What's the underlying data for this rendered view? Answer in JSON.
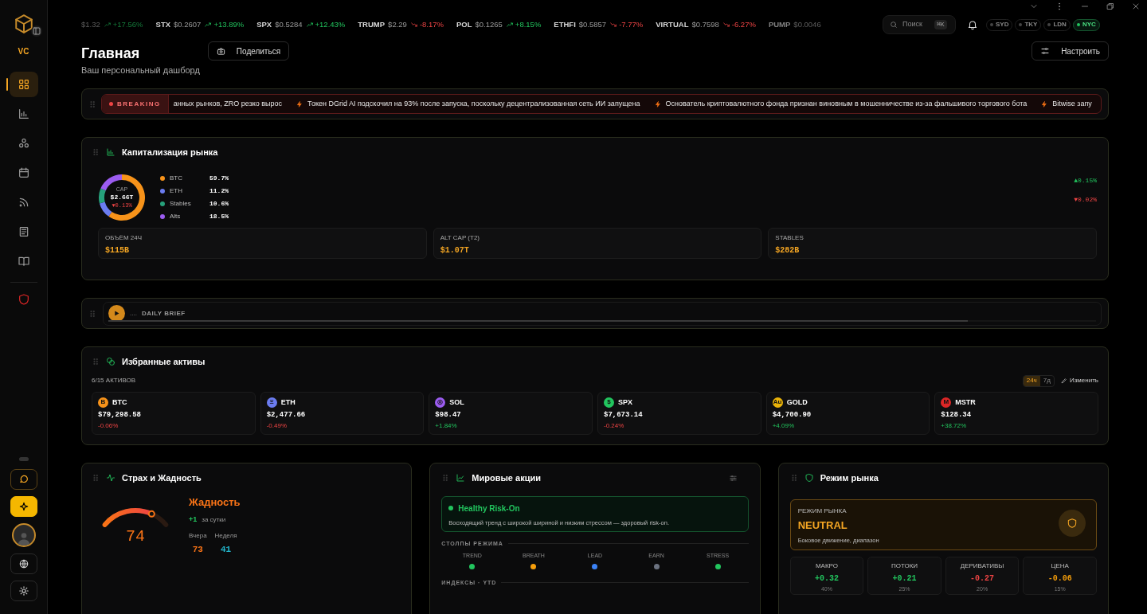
{
  "sidebar": {
    "logo_text": "VC",
    "nav": [
      {
        "selected": true
      },
      {
        "selected": false
      },
      {
        "selected": false
      },
      {
        "selected": false
      },
      {
        "selected": false
      },
      {
        "selected": false
      },
      {
        "selected": false
      },
      {
        "selected": false
      }
    ]
  },
  "ticker": [
    {
      "price": "$1.32",
      "change": "+17.56%",
      "kind": "up",
      "faded": true
    },
    {
      "symbol": "STX",
      "price": "$0.2607",
      "change": "+13.89%",
      "kind": "up",
      "faded": false
    },
    {
      "symbol": "SPX",
      "price": "$0.5284",
      "change": "+12.43%",
      "kind": "up",
      "faded": false
    },
    {
      "symbol": "TRUMP",
      "price": "$2.29",
      "change": "-8.17%",
      "kind": "down",
      "faded": false
    },
    {
      "symbol": "POL",
      "price": "$0.1265",
      "change": "+8.15%",
      "kind": "up",
      "faded": false
    },
    {
      "symbol": "ETHFI",
      "price": "$0.5857",
      "change": "-7.77%",
      "kind": "down",
      "faded": false
    },
    {
      "symbol": "VIRTUAL",
      "price": "$0.7598",
      "change": "-6.27%",
      "kind": "down",
      "faded": false
    },
    {
      "symbol": "PUMP",
      "price": "$0.0046",
      "faded": true
    }
  ],
  "search": {
    "placeholder": "Поиск",
    "shortcut": "⌘K"
  },
  "sessions": [
    {
      "label": "SYD",
      "selected": false
    },
    {
      "label": "TKY",
      "selected": false
    },
    {
      "label": "LDN",
      "selected": false
    },
    {
      "label": "NYC",
      "selected": true
    }
  ],
  "header": {
    "title": "Главная",
    "subtitle": "Ваш персональный дашборд",
    "share": "Поделиться",
    "customize": "Настроить"
  },
  "breaking": {
    "label": "BREAKING",
    "headlines": [
      {
        "text": "анных рынков, ZRO резко вырос",
        "bolt": false
      },
      {
        "text": "Токен DGrid AI подскочил на 93% после запуска, поскольку децентрализованная сеть ИИ запущена",
        "bolt": true
      },
      {
        "text": "Основатель криптовалютного фонда признан виновным в мошенничестве из-за фальшивого торгового бота",
        "bolt": true
      },
      {
        "text": "Bitwise запу",
        "bolt": true
      }
    ]
  },
  "market_cap": {
    "title": "Капитализация рынка",
    "donut": {
      "label": "CAP",
      "total": "$2.66T",
      "change": "▼0.13%",
      "kind": "down",
      "chart_data": {
        "type": "donut",
        "categories": [
          "BTC",
          "ETH",
          "Stables",
          "Alts"
        ],
        "values": [
          59.7,
          11.2,
          10.6,
          18.5
        ]
      }
    },
    "legend": [
      {
        "value": "59.7%",
        "color": "#f7931a"
      },
      {
        "value": "11.2%",
        "color": "#6b7cf0"
      },
      {
        "value": "10.6%",
        "color": "#26a17b"
      },
      {
        "value": "18.5%",
        "color": "#9b5cf0"
      }
    ],
    "side_changes": [
      {
        "text": "▲0.15%",
        "kind": "up"
      },
      {
        "text": "▼0.02%",
        "kind": "down"
      }
    ],
    "stats": [
      {
        "label": "ОБЪЁМ 24Ч",
        "value": "$115B"
      },
      {
        "label": "ALT CAP (T2)",
        "value": "$1.07T"
      },
      {
        "label": "STABLES",
        "value": "$282B"
      }
    ]
  },
  "daily_brief": {
    "dots": "....",
    "label": "DAILY BRIEF",
    "level": 0.87
  },
  "favorites": {
    "title": "Избранные активы",
    "count": "6/15 АКТИВОВ",
    "periods": [
      {
        "label": "24ч",
        "selected": true
      },
      {
        "label": "7д",
        "selected": false
      }
    ],
    "edit": "Изменить",
    "assets": [
      {
        "badge": "B",
        "color": "#f7931a",
        "symbol": "BTC",
        "price": "$79,298.58",
        "change": "-0.06%",
        "kind": "down"
      },
      {
        "badge": "Ξ",
        "color": "#6b7cf0",
        "symbol": "ETH",
        "price": "$2,477.66",
        "change": "-0.49%",
        "kind": "down"
      },
      {
        "badge": "◎",
        "color": "#9b5cf0",
        "symbol": "SOL",
        "price": "$98.47",
        "change": "+1.84%",
        "kind": "up"
      },
      {
        "badge": "$",
        "color": "#22c55e",
        "symbol": "SPX",
        "price": "$7,673.14",
        "change": "-0.24%",
        "kind": "down"
      },
      {
        "badge": "Au",
        "color": "#eab308",
        "symbol": "GOLD",
        "price": "$4,700.90",
        "change": "+4.09%",
        "kind": "up"
      },
      {
        "badge": "M",
        "color": "#dc2626",
        "symbol": "MSTR",
        "price": "$128.34",
        "change": "+38.72%",
        "kind": "up"
      }
    ]
  },
  "fear_greed": {
    "title": "Страх и Жадность",
    "value": "74",
    "level": 0.74,
    "label": "Жадность",
    "delta": "+1",
    "delta_label": "за сутки",
    "history": [
      {
        "label": "Вчера",
        "value": "73",
        "color": "#f97316"
      },
      {
        "label": "Неделя",
        "value": "41",
        "color": "#22b8cf"
      }
    ]
  },
  "world_stocks": {
    "title": "Мировые акции",
    "regime": "Healthy Risk-On",
    "description": "Восходящий тренд с широкой шириной и низким стрессом — здоровый risk-on.",
    "pillars_title": "СТОЛПЫ РЕЖИМА",
    "pillars": [
      {
        "label": "TREND",
        "color": "#22c55e"
      },
      {
        "label": "BREATH",
        "color": "#f59e0b"
      },
      {
        "label": "LEAD",
        "color": "#3b82f6"
      },
      {
        "label": "EARN",
        "color": "#6b7280"
      },
      {
        "label": "STRESS",
        "color": "#22c55e"
      }
    ],
    "indices_title": "ИНДЕКСЫ · YTD"
  },
  "market_regime": {
    "title": "Режим рынка",
    "label": "РЕЖИМ РЫНКА",
    "value": "NEUTRAL",
    "description": "Боковое движение, диапазон",
    "metrics": [
      {
        "label": "МАКРО",
        "value": "+0.32",
        "weight": "40%",
        "kind": "up"
      },
      {
        "label": "ПОТОКИ",
        "value": "+0.21",
        "weight": "25%",
        "kind": "up"
      },
      {
        "label": "ДЕРИВАТИВЫ",
        "value": "-0.27",
        "weight": "20%",
        "kind": "down"
      },
      {
        "label": "ЦЕНА",
        "value": "-0.06",
        "weight": "15%",
        "kind": "flat"
      }
    ]
  }
}
